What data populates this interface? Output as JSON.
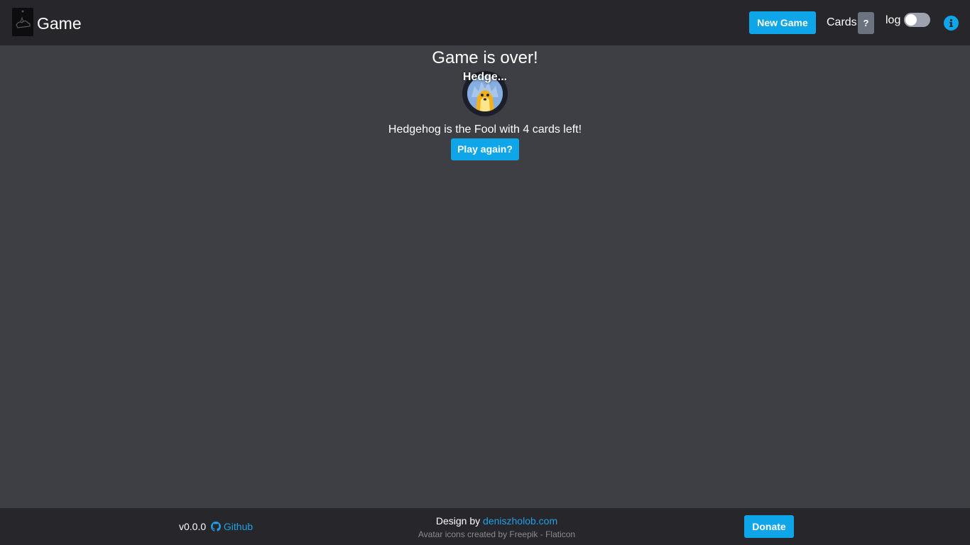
{
  "header": {
    "brand": "Game",
    "new_game_label": "New Game",
    "cards_label": "Cards",
    "cards_count": "?",
    "log_label": "log",
    "log_enabled": false
  },
  "main": {
    "title": "Game is over!",
    "player_name": "Hedge...",
    "result": "Hedgehog is the Fool with 4 cards left!",
    "play_again_label": "Play again?"
  },
  "footer": {
    "version": "v0.0.0",
    "github_label": "Github",
    "design_prefix": "Design by ",
    "design_link": "deniszholob.com",
    "credit": "Avatar icons created by Freepik - Flaticon",
    "donate_label": "Donate"
  },
  "colors": {
    "accent": "#0ea5e9",
    "background": "#3e3f45",
    "bar": "#27272b"
  },
  "icons": [
    "logo-icon",
    "info-icon",
    "github-icon",
    "hedgehog-avatar-icon"
  ]
}
